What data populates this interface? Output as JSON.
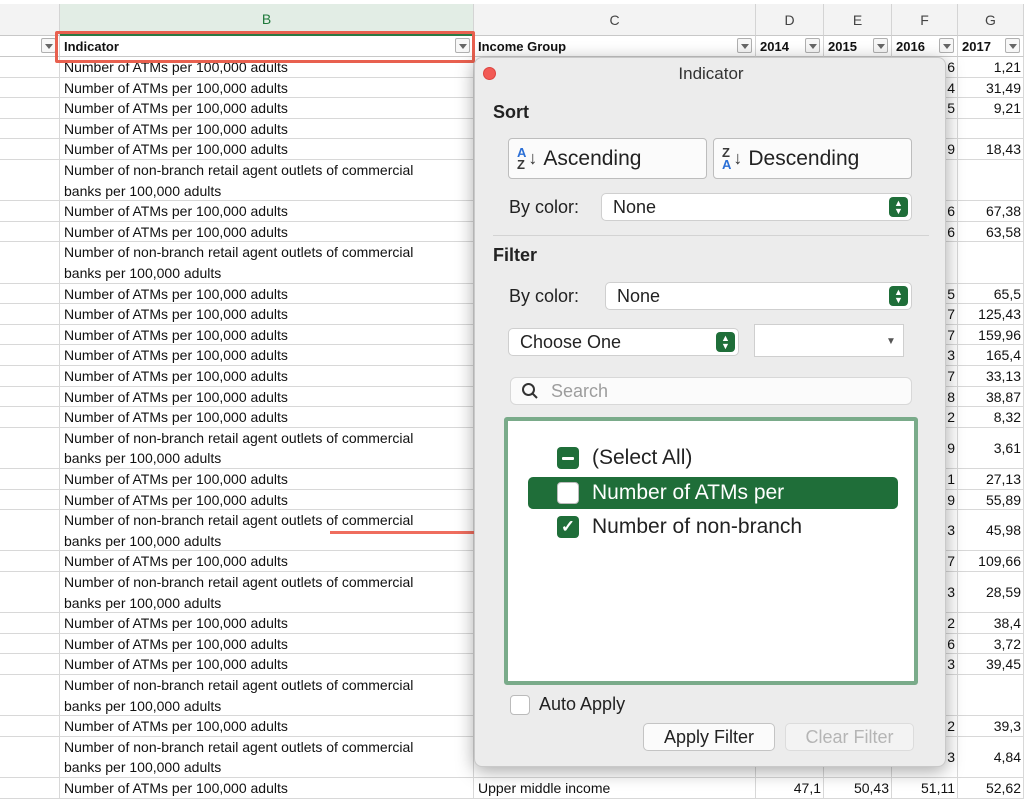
{
  "columns": {
    "b": "B",
    "c": "C",
    "d": "D",
    "e": "E",
    "f": "F",
    "g": "G"
  },
  "headers": {
    "indicator": "Indicator",
    "income_group": "Income Group",
    "y2014": "2014",
    "y2015": "2015",
    "y2016": "2016",
    "y2017": "2017"
  },
  "rows": [
    {
      "text": "Number of ATMs per 100,000 adults",
      "f": "6",
      "g": "1,21"
    },
    {
      "text": "Number of ATMs per 100,000 adults",
      "f": "4",
      "g": "31,49"
    },
    {
      "text": "Number of ATMs per 100,000 adults",
      "f": "5",
      "g": "9,21"
    },
    {
      "text": "Number of ATMs per 100,000 adults",
      "f": "",
      "g": ""
    },
    {
      "text": "Number of ATMs per 100,000 adults",
      "f": "9",
      "g": "18,43"
    },
    {
      "text": "Number of non-branch retail agent outlets of commercial",
      "text2": "banks per 100,000 adults",
      "f": "",
      "g": ""
    },
    {
      "text": "Number of ATMs per 100,000 adults",
      "f": "6",
      "g": "67,38"
    },
    {
      "text": "Number of ATMs per 100,000 adults",
      "f": "6",
      "g": "63,58"
    },
    {
      "text": "Number of non-branch retail agent outlets of commercial",
      "text2": "banks per 100,000 adults",
      "f": "",
      "g": ""
    },
    {
      "text": "Number of ATMs per 100,000 adults",
      "f": "5",
      "g": "65,5"
    },
    {
      "text": "Number of ATMs per 100,000 adults",
      "f": "7",
      "g": "125,43"
    },
    {
      "text": "Number of ATMs per 100,000 adults",
      "f": "7",
      "g": "159,96"
    },
    {
      "text": "Number of ATMs per 100,000 adults",
      "f": "3",
      "g": "165,4"
    },
    {
      "text": "Number of ATMs per 100,000 adults",
      "f": "7",
      "g": "33,13"
    },
    {
      "text": "Number of ATMs per 100,000 adults",
      "f": "8",
      "g": "38,87"
    },
    {
      "text": "Number of ATMs per 100,000 adults",
      "f": "2",
      "g": "8,32"
    },
    {
      "text": "Number of non-branch retail agent outlets of commercial",
      "text2": "banks per 100,000 adults",
      "f": "9",
      "g": "3,61"
    },
    {
      "text": "Number of ATMs per 100,000 adults",
      "f": "1",
      "g": "27,13"
    },
    {
      "text": "Number of ATMs per 100,000 adults",
      "f": "9",
      "g": "55,89"
    },
    {
      "text": "Number of non-branch retail agent outlets of commercial",
      "text2": "banks per 100,000 adults",
      "f": "3",
      "g": "45,98"
    },
    {
      "text": "Number of ATMs per 100,000 adults",
      "f": "7",
      "g": "109,66"
    },
    {
      "text": "Number of non-branch retail agent outlets of commercial",
      "text2": "banks per 100,000 adults",
      "f": "3",
      "g": "28,59"
    },
    {
      "text": "Number of ATMs per 100,000 adults",
      "f": "2",
      "g": "38,4"
    },
    {
      "text": "Number of ATMs per 100,000 adults",
      "f": "6",
      "g": "3,72"
    },
    {
      "text": "Number of ATMs per 100,000 adults",
      "f": "3",
      "g": "39,45"
    },
    {
      "text": "Number of non-branch retail agent outlets of commercial",
      "text2": "banks per 100,000 adults",
      "f": "",
      "g": ""
    },
    {
      "text": "Number of ATMs per 100,000 adults",
      "f": "2",
      "g": "39,3"
    },
    {
      "text": "Number of non-branch retail agent outlets of commercial",
      "text2": "banks per 100,000 adults",
      "f": "3",
      "g": "4,84"
    },
    {
      "text": "Number of ATMs per 100,000 adults",
      "c": "Upper middle income",
      "d": "47,1",
      "e": "50,43",
      "f": "51,11",
      "g": "52,62"
    }
  ],
  "popup": {
    "title": "Indicator",
    "sort_title": "Sort",
    "ascending": "Ascending",
    "descending": "Descending",
    "by_color_label": "By color:",
    "sort_color_value": "None",
    "filter_title": "Filter",
    "filter_color_value": "None",
    "choose_one": "Choose One",
    "search_placeholder": "Search",
    "items": [
      {
        "label": "(Select All)",
        "state": "mixed"
      },
      {
        "label": "Number of ATMs per",
        "state": "unchecked"
      },
      {
        "label": "Number of non-branch",
        "state": "checked"
      }
    ],
    "auto_apply": "Auto Apply",
    "apply_filter": "Apply Filter",
    "clear_filter": "Clear Filter"
  },
  "colors": {
    "accent": "#1f6e39",
    "highlight": "#e8604f"
  }
}
